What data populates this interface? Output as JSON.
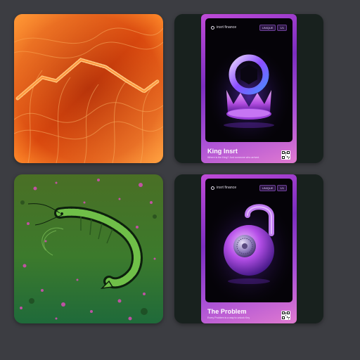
{
  "gallery": {
    "tiles": [
      {
        "kind": "artwork",
        "art_icon": "abstract-orange-swirl-art"
      },
      {
        "kind": "nft-card",
        "brand": "insrt finance",
        "badge_rarity": "UNIQUE",
        "badge_count": "1/1",
        "title": "King Insrt",
        "subtitle": "Where is the King? Just someone who arrived.",
        "art_icon": "crown-icon"
      },
      {
        "kind": "artwork",
        "art_icon": "shrimp-art"
      },
      {
        "kind": "nft-card",
        "brand": "insrt finance",
        "badge_rarity": "UNIQUE",
        "badge_count": "1/1",
        "title": "The Problem",
        "subtitle": "Every Problem is a way to unlock Key",
        "art_icon": "padlock-icon"
      }
    ]
  },
  "colors": {
    "background": "#3c3d42",
    "tile_dark": "#18211e",
    "card_purple": "#a84fd6",
    "art_orange": "#e0530f",
    "art_green": "#3d7a2c"
  }
}
